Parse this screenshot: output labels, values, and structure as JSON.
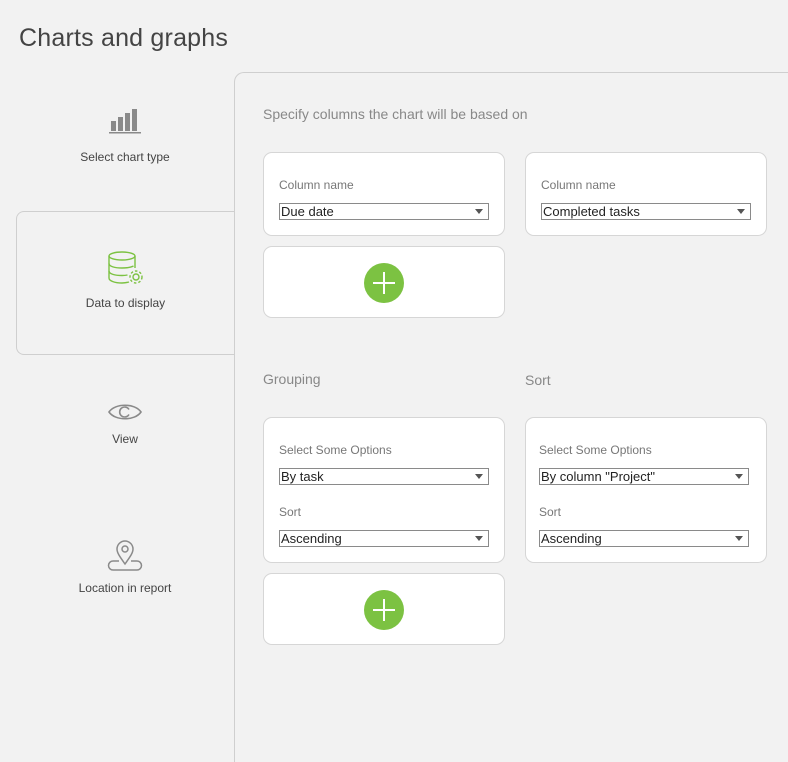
{
  "page_title": "Charts and graphs",
  "sidebar": {
    "items": [
      {
        "label": "Select chart type",
        "icon": "bar-chart-icon",
        "active": false
      },
      {
        "label": "Data to display",
        "icon": "database-settings-icon",
        "active": true
      },
      {
        "label": "View",
        "icon": "eye-icon",
        "active": false
      },
      {
        "label": "Location in report",
        "icon": "location-pin-icon",
        "active": false
      }
    ]
  },
  "columns_section": {
    "heading": "Specify columns the chart will be based on",
    "cards": [
      {
        "label": "Column name",
        "value": "Due date"
      },
      {
        "label": "Column name",
        "value": "Completed tasks"
      }
    ],
    "add_icon": "plus-icon"
  },
  "grouping_section": {
    "heading": "Grouping",
    "card": {
      "options_label": "Select Some Options",
      "options_value": "By task",
      "sort_label": "Sort",
      "sort_value": "Ascending"
    },
    "add_icon": "plus-icon"
  },
  "sort_section": {
    "heading": "Sort",
    "card": {
      "options_label": "Select Some Options",
      "options_value": "By column \"Project\"",
      "sort_label": "Sort",
      "sort_value": "Ascending"
    }
  },
  "colors": {
    "accent_green": "#7cc242",
    "icon_gray": "#8a8a8a",
    "background": "#f2f2f2",
    "card_background": "#ffffff"
  }
}
